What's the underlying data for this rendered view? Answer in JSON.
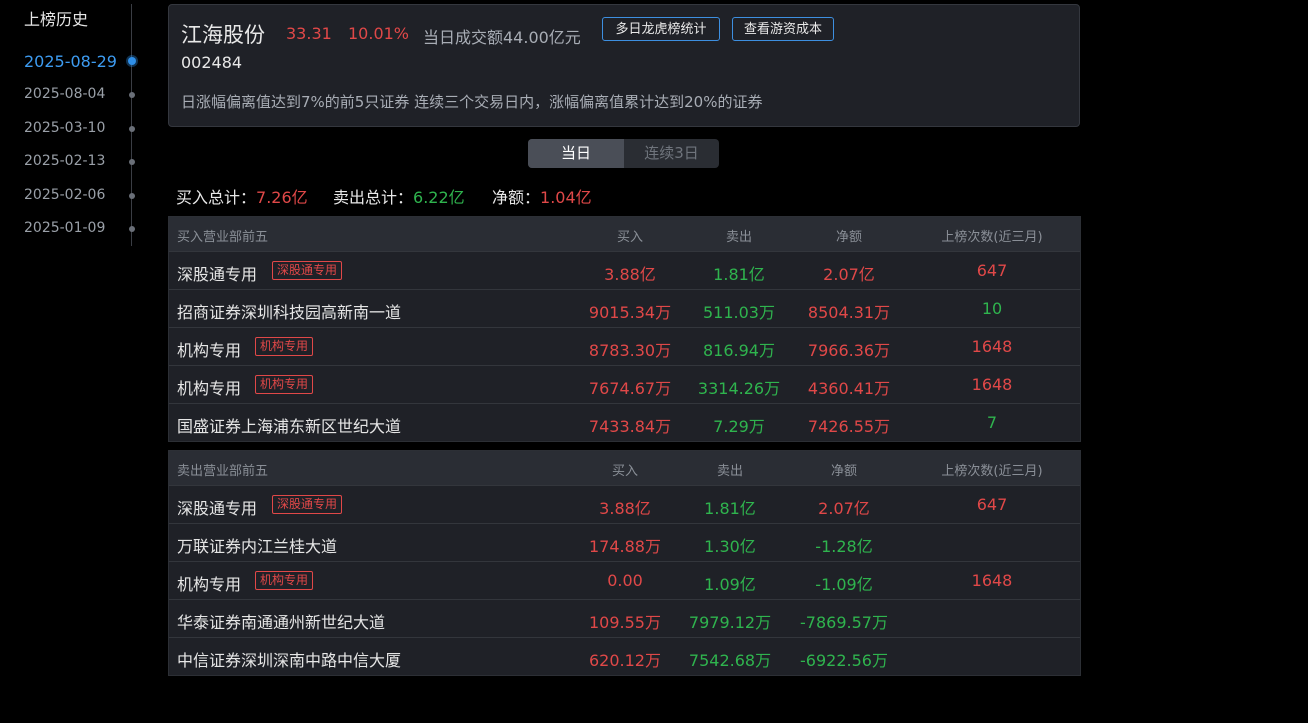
{
  "sidebar": {
    "title": "上榜历史",
    "dates": [
      "2025-08-29",
      "2025-08-04",
      "2025-03-10",
      "2025-02-13",
      "2025-02-06",
      "2025-01-09"
    ]
  },
  "header": {
    "stock_name": "江海股份",
    "price": "33.31",
    "change_pct": "10.01%",
    "turnover": "当日成交额44.00亿元",
    "btn_multi_day": "多日龙虎榜统计",
    "btn_hot_money_cost": "查看游资成本",
    "code": "002484",
    "reason": "日涨幅偏离值达到7%的前5只证券 连续三个交易日内，涨幅偏离值累计达到20%的证券"
  },
  "tabs": {
    "today": "当日",
    "three_days": "连续3日"
  },
  "totals": {
    "buy_label": "买入总计：",
    "buy_value": "7.26亿",
    "sell_label": "卖出总计：",
    "sell_value": "6.22亿",
    "net_label": "净额：",
    "net_value": "1.04亿"
  },
  "buy_table": {
    "headers": [
      "买入营业部前五",
      "买入",
      "卖出",
      "净额",
      "上榜次数(近三月)"
    ],
    "rows": [
      {
        "name": "深股通专用",
        "tag": "深股通专用",
        "buy": "3.88亿",
        "sell": "1.81亿",
        "net": "2.07亿",
        "count": "647"
      },
      {
        "name": "招商证券深圳科技园高新南一道",
        "tag": "",
        "buy": "9015.34万",
        "sell": "511.03万",
        "net": "8504.31万",
        "count": "10"
      },
      {
        "name": "机构专用",
        "tag": "机构专用",
        "buy": "8783.30万",
        "sell": "816.94万",
        "net": "7966.36万",
        "count": "1648"
      },
      {
        "name": "机构专用",
        "tag": "机构专用",
        "buy": "7674.67万",
        "sell": "3314.26万",
        "net": "4360.41万",
        "count": "1648"
      },
      {
        "name": "国盛证券上海浦东新区世纪大道",
        "tag": "",
        "buy": "7433.84万",
        "sell": "7.29万",
        "net": "7426.55万",
        "count": "7"
      }
    ]
  },
  "sell_table": {
    "headers": [
      "卖出营业部前五",
      "买入",
      "卖出",
      "净额",
      "上榜次数(近三月)"
    ],
    "rows": [
      {
        "name": "深股通专用",
        "tag": "深股通专用",
        "buy": "3.88亿",
        "sell": "1.81亿",
        "net": "2.07亿",
        "count": "647"
      },
      {
        "name": "万联证券内江兰桂大道",
        "tag": "",
        "buy": "174.88万",
        "sell": "1.30亿",
        "net": "-1.28亿",
        "count": ""
      },
      {
        "name": "机构专用",
        "tag": "机构专用",
        "buy": "0.00",
        "sell": "1.09亿",
        "net": "-1.09亿",
        "count": "1648"
      },
      {
        "name": "华泰证券南通通州新世纪大道",
        "tag": "",
        "buy": "109.55万",
        "sell": "7979.12万",
        "net": "-7869.57万",
        "count": ""
      },
      {
        "name": "中信证券深圳深南中路中信大厦",
        "tag": "",
        "buy": "620.12万",
        "sell": "7542.68万",
        "net": "-6922.56万",
        "count": ""
      }
    ]
  },
  "colors": {
    "up": "#e04848",
    "down": "#2fb44e",
    "accent": "#3d9bf0"
  }
}
